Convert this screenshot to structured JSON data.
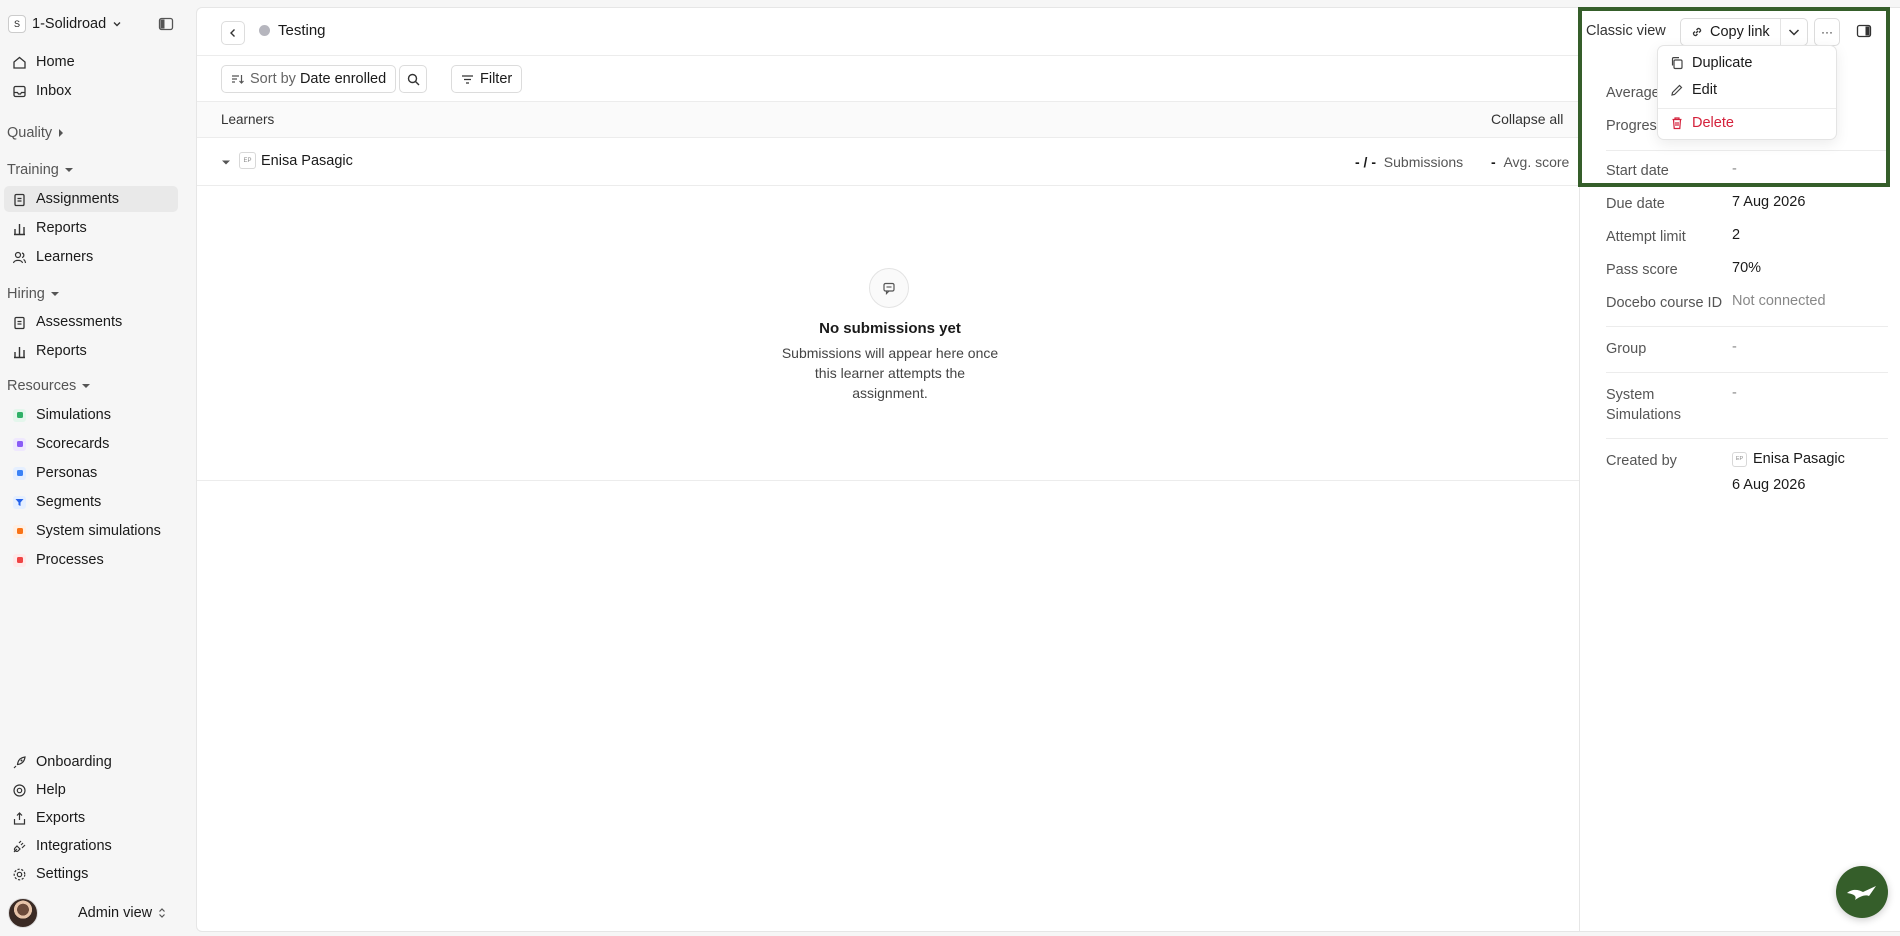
{
  "workspace": {
    "name": "1-Solidroad",
    "logo_char": "S"
  },
  "sidebar": {
    "home": "Home",
    "inbox": "Inbox",
    "quality": "Quality",
    "training": "Training",
    "training_items": [
      "Assignments",
      "Reports",
      "Learners"
    ],
    "hiring": "Hiring",
    "hiring_items": [
      "Assessments",
      "Reports"
    ],
    "resources": "Resources",
    "resource_items": [
      "Simulations",
      "Scorecards",
      "Personas",
      "Segments",
      "System simulations",
      "Processes"
    ],
    "bottom_items": [
      "Onboarding",
      "Help",
      "Exports",
      "Integrations",
      "Settings"
    ],
    "admin_label": "Admin view",
    "colors": {
      "simulations": "#2fb067",
      "scorecards": "#8a5cf6",
      "personas": "#3b82f6",
      "segments": "#2563eb",
      "system_simulations": "#f97316",
      "processes": "#ef4444"
    }
  },
  "main": {
    "title": "Testing",
    "sort_prefix": "Sort by",
    "sort_value": "Date enrolled",
    "filter_label": "Filter",
    "col_learners": "Learners",
    "collapse_all": "Collapse all",
    "learner": {
      "initials": "EP",
      "name": "Enisa Pasagic",
      "subs_value": "- / -",
      "subs_label": "Submissions",
      "avg_value": "-",
      "avg_label": "Avg. score"
    },
    "empty": {
      "title": "No submissions yet",
      "text": "Submissions will appear here once this learner attempts the assignment."
    }
  },
  "details": {
    "classic_view": "Classic view",
    "copy_link": "Copy link",
    "more": "···",
    "average_label": "Average",
    "progress_label": "Progress",
    "start_date_label": "Start date",
    "start_date_value": "-",
    "due_date_label": "Due date",
    "due_date_value": "7 Aug 2026",
    "attempt_limit_label": "Attempt limit",
    "attempt_limit_value": "2",
    "pass_score_label": "Pass score",
    "pass_score_value": "70%",
    "docebo_label": "Docebo course ID",
    "docebo_value": "Not connected",
    "group_label": "Group",
    "group_value": "-",
    "system_sim_label": "System Simulations",
    "system_sim_value": "-",
    "created_by_label": "Created by",
    "created_by_initials": "EP",
    "created_by_name": "Enisa Pasagic",
    "created_date": "6 Aug 2026"
  },
  "menu": {
    "duplicate": "Duplicate",
    "edit": "Edit",
    "delete": "Delete",
    "delete_color": "#d4213b"
  },
  "accent": "#355e2a"
}
